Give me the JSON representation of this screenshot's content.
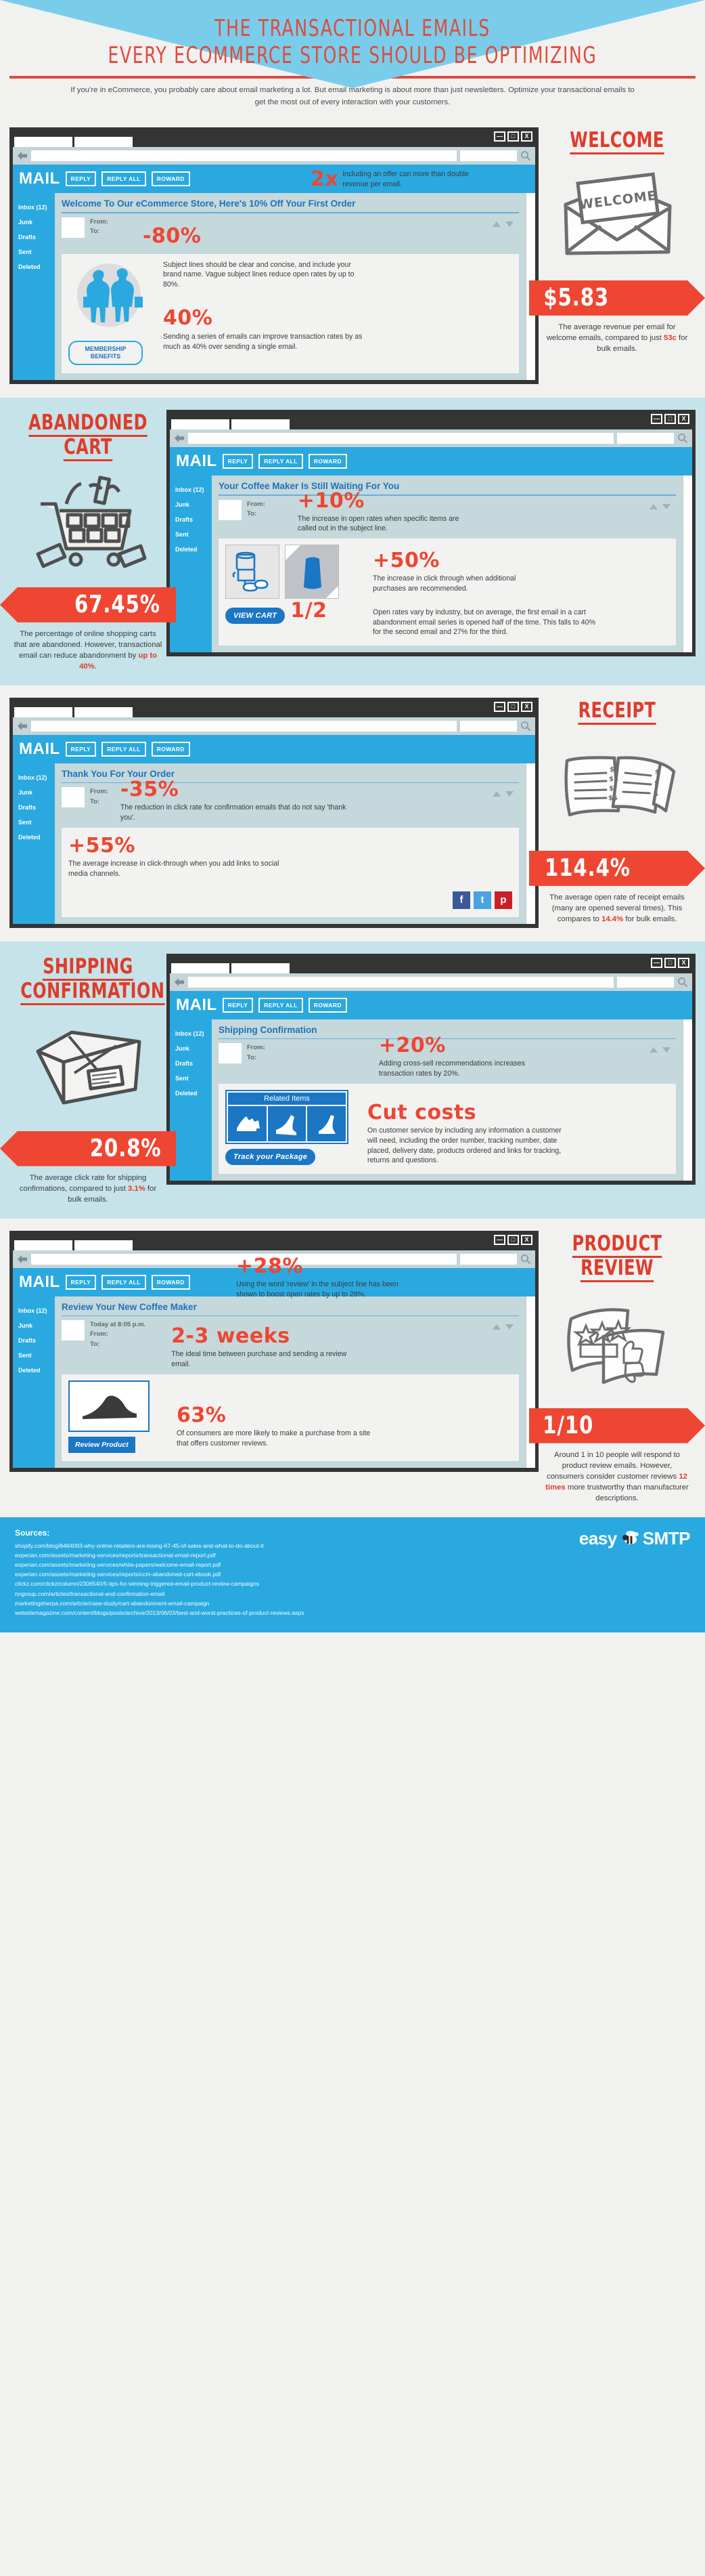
{
  "header": {
    "title_line1": "THE TRANSACTIONAL EMAILS",
    "title_line2": "EVERY ECOMMERCE STORE SHOULD BE OPTIMIZING",
    "intro": "If you're in eCommerce, you probably care about email marketing a lot. But email marketing is about more than just newsletters. Optimize your transactional emails to get the most out of every interaction with your customers."
  },
  "mail_ui": {
    "logo": "MAIL",
    "buttons": [
      "REPLY",
      "REPLY ALL",
      "ROWARD"
    ],
    "folders": [
      "Inbox (12)",
      "Junk",
      "Drafts",
      "Sent",
      "Deleted"
    ],
    "from_label": "From:",
    "to_label": "To:",
    "window_controls": [
      "—",
      "□",
      "X"
    ]
  },
  "sections": [
    {
      "id": "welcome",
      "title": "WELCOME",
      "title_lines": [
        "WELCOME"
      ],
      "sketch": "envelope-welcome-icon",
      "stat": "$5.83",
      "stat_note_pre": "The average revenue per email for welcome emails, compared to just ",
      "stat_note_hl": "53c",
      "stat_note_post": " for bulk emails.",
      "subject": "Welcome To Our eCommerce Store, Here's 10% Off Your First Order",
      "cta": "MEMBERSHIP BENEFITS",
      "annotations": [
        {
          "figure": "2x",
          "text": "Including an offer can more than double revenue per email."
        },
        {
          "figure": "-80%",
          "text": "Subject lines should be clear and concise, and include your brand name. Vague subject lines reduce open rates by up to 80%."
        },
        {
          "figure": "40%",
          "text": "Sending a series of emails can improve transaction rates by as much as 40% over sending a single email."
        }
      ]
    },
    {
      "id": "abandoned-cart",
      "title": "ABANDONED CART",
      "title_lines": [
        "ABANDONED",
        "CART"
      ],
      "sketch": "shopping-cart-icon",
      "stat": "67.45%",
      "stat_note_pre": "The percentage of online shopping carts that are abandoned. However, transactional email can reduce abandonment by ",
      "stat_note_hl": "up to 40%",
      "stat_note_post": ".",
      "subject": "Your Coffee Maker Is Still Waiting For You",
      "cta": "VIEW CART",
      "annotations": [
        {
          "figure": "+10%",
          "text": "The increase in open rates when specific items are called out in the subject line."
        },
        {
          "figure": "+50%",
          "text": "The increase in click through when additional purchases are recommended."
        },
        {
          "figure": "1/2",
          "text": "Open rates vary by industry, but on average, the first email in a cart abandonment email series is opened half of the time. This falls to 40% for the second email and 27% for the third."
        }
      ]
    },
    {
      "id": "receipt",
      "title": "RECEIPT",
      "title_lines": [
        "RECEIPT"
      ],
      "sketch": "receipt-icon",
      "stat": "114.4%",
      "stat_note_pre": "The average open rate of receipt emails (many are opened several times). This compares to ",
      "stat_note_hl": "14.4%",
      "stat_note_post": " for bulk emails.",
      "subject": "Thank You For Your Order",
      "cta": "",
      "social": [
        "facebook-icon",
        "twitter-icon",
        "pinterest-icon"
      ],
      "annotations": [
        {
          "figure": "-35%",
          "text": "The reduction in click rate for confirmation emails that do not say 'thank you'."
        },
        {
          "figure": "+55%",
          "text": "The average increase in click-through when you add links to social media channels."
        }
      ]
    },
    {
      "id": "shipping-confirmation",
      "title": "SHIPPING CONFIRMATION",
      "title_lines": [
        "SHIPPING",
        "CONFIRMATION"
      ],
      "sketch": "package-box-icon",
      "stat": "20.8%",
      "stat_note_pre": "The average click rate for shipping confirmations, compared to just ",
      "stat_note_hl": "3.1%",
      "stat_note_post": " for bulk emails.",
      "subject": "Shipping Confirmation",
      "related_heading": "Related Items",
      "cta": "Track your Package",
      "annotations": [
        {
          "figure": "+20%",
          "text": "Adding cross-sell recommendations increases transaction rates by 20%."
        },
        {
          "figure": "Cut costs",
          "text": "On customer service by including any information a customer will need, including the order number, tracking number, date placed, delivery date, products ordered and links for tracking, returns and questions."
        }
      ]
    },
    {
      "id": "product-review",
      "title": "PRODUCT REVIEW",
      "title_lines": [
        "PRODUCT",
        "REVIEW"
      ],
      "sketch": "review-papers-icon",
      "stat": "1/10",
      "stat_note_pre": "Around 1 in 10 people will respond to product review emails. However, consumers consider customer reviews ",
      "stat_note_hl": "12 times",
      "stat_note_post": " more trustworthy than manufacturer descriptions.",
      "subject": "Review Your New Coffee Maker",
      "timestamp": "Today at 8:05 p.m.",
      "cta": "Review Product",
      "annotations": [
        {
          "figure": "+28%",
          "text": "Using the word 'review' in the subject line has been shown to boost open rates by up to 28%."
        },
        {
          "figure": "2-3 weeks",
          "text": "The ideal time between purchase and sending a review email."
        },
        {
          "figure": "63%",
          "text": "Of consumers are more likely to make a purchase from a site that offers customer reviews."
        }
      ]
    }
  ],
  "footer": {
    "sources_heading": "Sources:",
    "sources": [
      "shopify.com/blog/8484093-why-online-retailers-are-losing-67-45-of-sales-and-what-to-do-about-it",
      "experian.com/assets/marketing-services/reports/transactional-email-report.pdf",
      "experian.com/assets/marketing-services/white-papers/welcome-email-report.pdf",
      "experian.com/assets/marketing-services/reports/ccm-abandoned-cart-ebook.pdf",
      "clickz.com/clickz/column/2306540/5-tips-for-winning-triggered-email-product-review-campaigns",
      "nngroup.com/articles/transactional-and-confirmation-email",
      "marketingsherpa.com/article/case-study/cart-abandonment-email-campaign",
      "websitemagazine.com/content/blogs/posts/archive/2013/06/03/best-and-worst-practices-of-product-reviews.aspx"
    ],
    "logo_easy": "easy",
    "logo_smtp": "SMTP"
  },
  "colors": {
    "red": "#ee4632",
    "blue": "#29a9e0",
    "tint": "#c5e3e8",
    "dark": "#343434",
    "subject_blue": "#1f72b8"
  }
}
